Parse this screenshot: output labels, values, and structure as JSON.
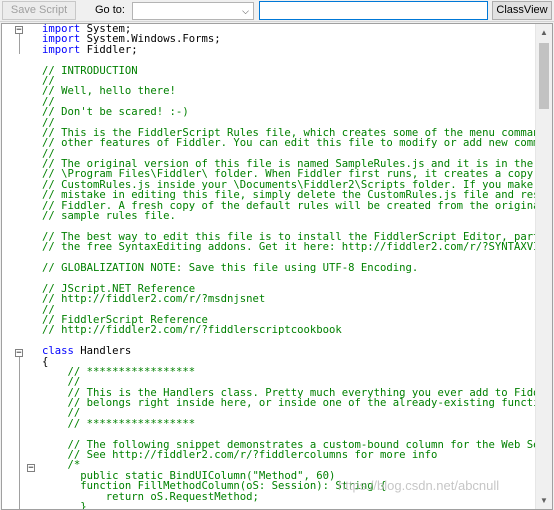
{
  "toolbar": {
    "save_label": "Save Script",
    "goto_label": "Go to:",
    "goto_selected": "",
    "search_value": "",
    "classview_label": "ClassView"
  },
  "editor": {
    "lines": [
      [
        {
          "t": "import",
          "c": "kw"
        },
        {
          "t": " System;"
        }
      ],
      [
        {
          "t": "import",
          "c": "kw"
        },
        {
          "t": " System.Windows.Forms;"
        }
      ],
      [
        {
          "t": "import",
          "c": "kw"
        },
        {
          "t": " Fiddler;"
        }
      ],
      [],
      [
        {
          "t": "// INTRODUCTION",
          "c": "cm"
        }
      ],
      [
        {
          "t": "//",
          "c": "cm"
        }
      ],
      [
        {
          "t": "// Well, hello there!",
          "c": "cm"
        }
      ],
      [
        {
          "t": "//",
          "c": "cm"
        }
      ],
      [
        {
          "t": "// Don't be scared! :-)",
          "c": "cm"
        }
      ],
      [
        {
          "t": "//",
          "c": "cm"
        }
      ],
      [
        {
          "t": "// This is the FiddlerScript Rules file, which creates some of the menu commands and",
          "c": "cm"
        }
      ],
      [
        {
          "t": "// other features of Fiddler. You can edit this file to modify or add new commands.",
          "c": "cm"
        }
      ],
      [
        {
          "t": "//",
          "c": "cm"
        }
      ],
      [
        {
          "t": "// The original version of this file is named SampleRules.js and it is in the",
          "c": "cm"
        }
      ],
      [
        {
          "t": "// \\Program Files\\Fiddler\\ folder. When Fiddler first runs, it creates a copy named",
          "c": "cm"
        }
      ],
      [
        {
          "t": "// CustomRules.js inside your \\Documents\\Fiddler2\\Scripts folder. If you make a",
          "c": "cm"
        }
      ],
      [
        {
          "t": "// mistake in editing this file, simply delete the CustomRules.js file and restart",
          "c": "cm"
        }
      ],
      [
        {
          "t": "// Fiddler. A fresh copy of the default rules will be created from the original",
          "c": "cm"
        }
      ],
      [
        {
          "t": "// sample rules file.",
          "c": "cm"
        }
      ],
      [],
      [
        {
          "t": "// The best way to edit this file is to install the FiddlerScript Editor, part of",
          "c": "cm"
        }
      ],
      [
        {
          "t": "// the free SyntaxEditing addons. Get it here: http://fiddler2.com/r/?SYNTAXVIEWINSTALL",
          "c": "cm"
        }
      ],
      [],
      [
        {
          "t": "// GLOBALIZATION NOTE: Save this file using UTF-8 Encoding.",
          "c": "cm"
        }
      ],
      [],
      [
        {
          "t": "// JScript.NET Reference",
          "c": "cm"
        }
      ],
      [
        {
          "t": "// http://fiddler2.com/r/?msdnjsnet",
          "c": "cm"
        }
      ],
      [
        {
          "t": "//",
          "c": "cm"
        }
      ],
      [
        {
          "t": "// FiddlerScript Reference",
          "c": "cm"
        }
      ],
      [
        {
          "t": "// http://fiddler2.com/r/?fiddlerscriptcookbook",
          "c": "cm"
        }
      ],
      [],
      [
        {
          "t": "class",
          "c": "kw"
        },
        {
          "t": " Handlers"
        }
      ],
      [
        {
          "t": "{"
        }
      ],
      [
        {
          "t": "    "
        },
        {
          "t": "// *****************",
          "c": "cm"
        }
      ],
      [
        {
          "t": "    "
        },
        {
          "t": "//",
          "c": "cm"
        }
      ],
      [
        {
          "t": "    "
        },
        {
          "t": "// This is the Handlers class. Pretty much everything you ever add to FiddlerScript",
          "c": "cm"
        }
      ],
      [
        {
          "t": "    "
        },
        {
          "t": "// belongs right inside here, or inside one of the already-existing functions below.",
          "c": "cm"
        }
      ],
      [
        {
          "t": "    "
        },
        {
          "t": "//",
          "c": "cm"
        }
      ],
      [
        {
          "t": "    "
        },
        {
          "t": "// *****************",
          "c": "cm"
        }
      ],
      [],
      [
        {
          "t": "    "
        },
        {
          "t": "// The following snippet demonstrates a custom-bound column for the Web Sessions list.",
          "c": "cm"
        }
      ],
      [
        {
          "t": "    "
        },
        {
          "t": "// See http://fiddler2.com/r/?fiddlercolumns for more info",
          "c": "cm"
        }
      ],
      [
        {
          "t": "    "
        },
        {
          "t": "/*",
          "c": "cm"
        }
      ],
      [
        {
          "t": "      public static BindUIColumn(\"Method\", 60)",
          "c": "cm"
        }
      ],
      [
        {
          "t": "      function FillMethodColumn(oS: Session): String {",
          "c": "cm"
        }
      ],
      [
        {
          "t": "          return oS.RequestMethod;",
          "c": "cm"
        }
      ],
      [
        {
          "t": "      }",
          "c": "cm"
        }
      ]
    ]
  },
  "watermark": "https://blog.csdn.net/abcnull",
  "icons": {
    "dropdown": "chevron-down-icon",
    "fold_collapse": "minus-box-icon",
    "scroll_up": "scroll-up-arrow-icon",
    "scroll_down": "scroll-down-arrow-icon"
  }
}
